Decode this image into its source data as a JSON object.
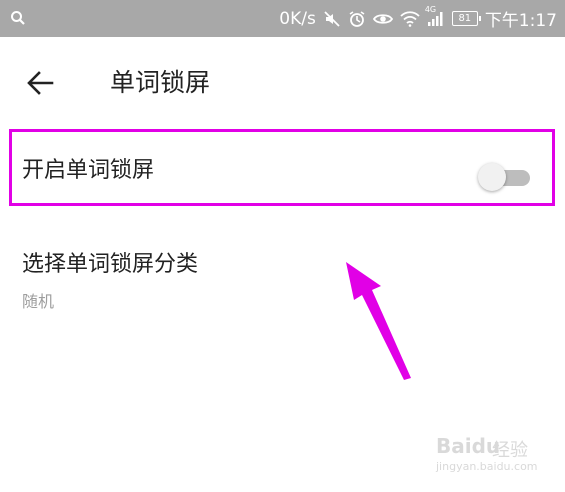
{
  "status_bar": {
    "network_speed": "0K/s",
    "network_type": "4G",
    "battery_level": "81",
    "time": "下午1:17",
    "icons": [
      "search-icon",
      "mute-icon",
      "alarm-icon",
      "eye-icon",
      "wifi-icon",
      "signal-icon",
      "battery-icon"
    ]
  },
  "header": {
    "title": "单词锁屏",
    "back_icon": "arrow-left-icon"
  },
  "settings": {
    "lock_screen_toggle": {
      "label": "开启单词锁屏",
      "enabled": false
    },
    "category": {
      "title": "选择单词锁屏分类",
      "value": "随机"
    }
  },
  "annotation": {
    "highlight_color": "#e100e6",
    "arrow_color": "#e100e6"
  },
  "watermark": {
    "brand": "Baidu",
    "jingyan": "经验",
    "url": "jingyan.baidu.com"
  }
}
